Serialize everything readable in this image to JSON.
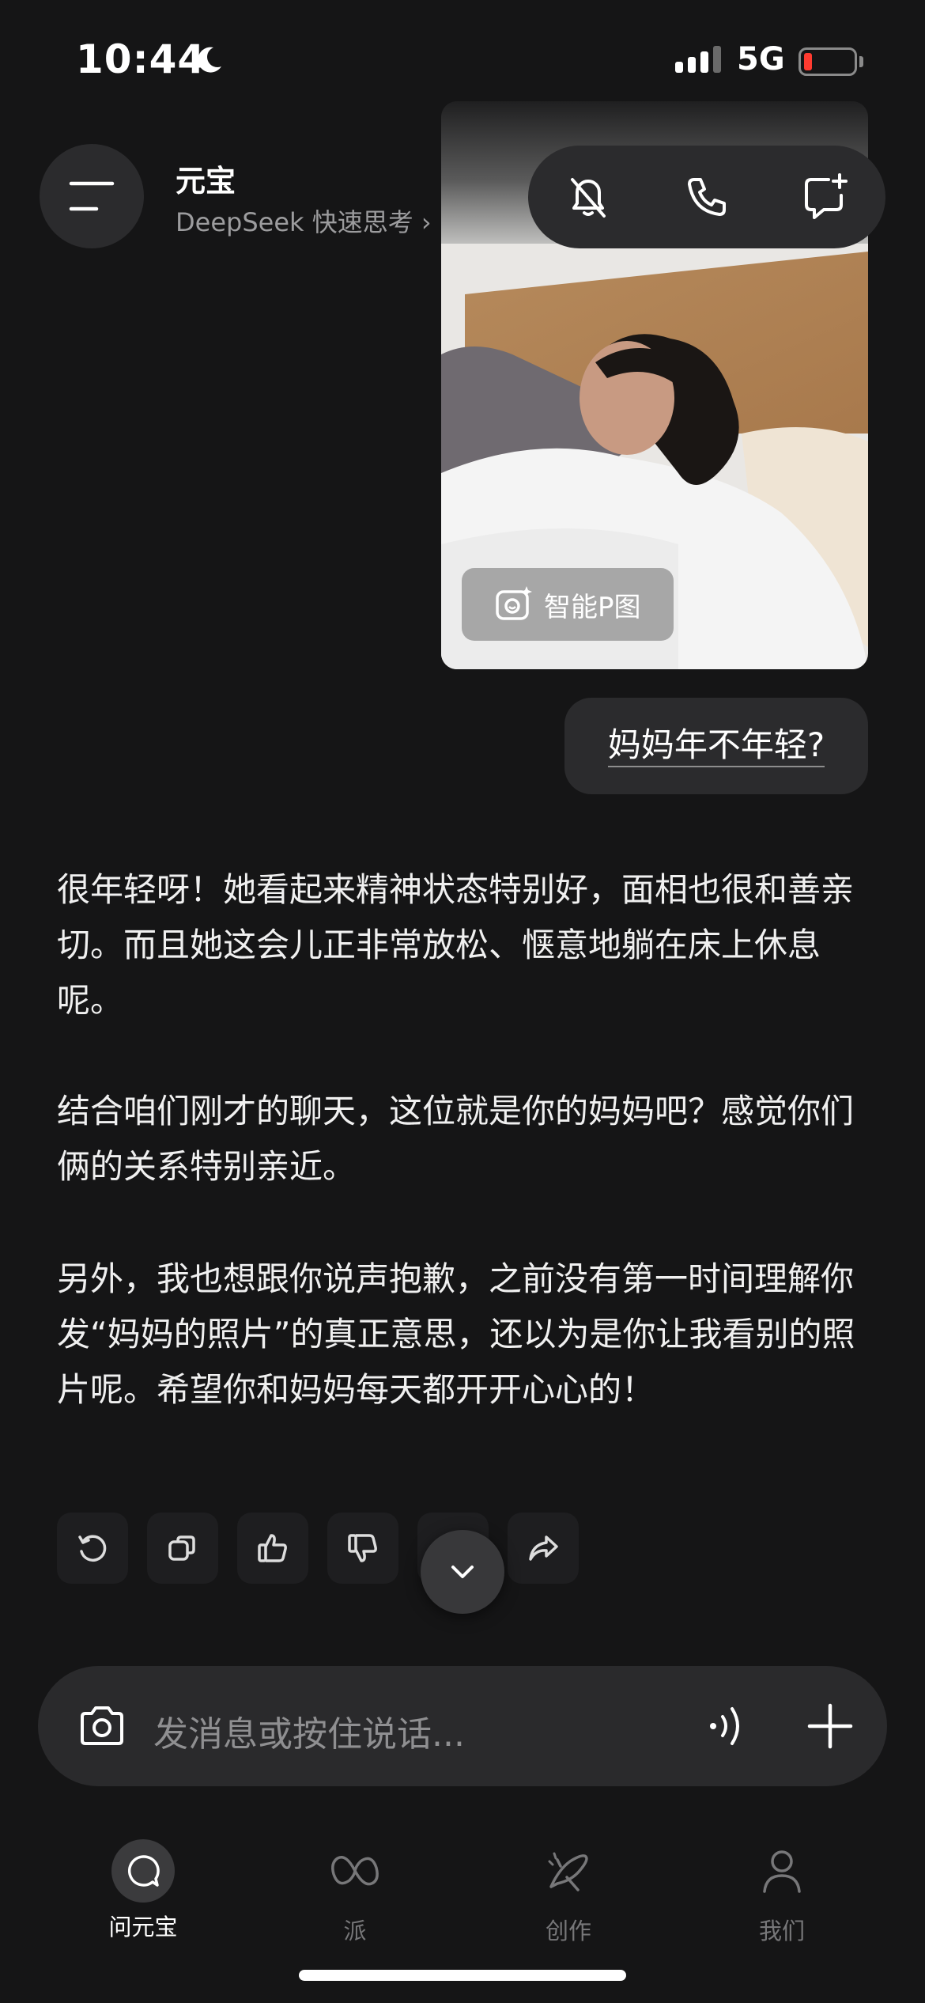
{
  "status_bar": {
    "time": "10:44",
    "network": "5G",
    "battery_level": 0.1
  },
  "header": {
    "title": "元宝",
    "subtitle": "DeepSeek 快速思考 ›",
    "icons": [
      "menu-icon",
      "mute-icon",
      "phone-icon",
      "new-chat-icon"
    ]
  },
  "image_message": {
    "smart_edit_label": "智能P图"
  },
  "user_message": {
    "text": "妈妈年不年轻?"
  },
  "assistant_reply": {
    "paragraphs": [
      "很年轻呀！她看起来精神状态特别好，面相也很和善亲切。而且她这会儿正非常放松、惬意地躺在床上休息呢。",
      "结合咱们刚才的聊天，这位就是你的妈妈吧？感觉你们俩的关系特别亲近。",
      "另外，我也想跟你说声抱歉，之前没有第一时间理解你发“妈妈的照片”的真正意思，还以为是你让我看别的照片呢。希望你和妈妈每天都开开心心的！"
    ],
    "actions": [
      "regenerate-icon",
      "copy-icon",
      "thumbs-up-icon",
      "thumbs-down-icon",
      "share-icon"
    ]
  },
  "input": {
    "placeholder": "发消息或按住说话..."
  },
  "tabs": [
    {
      "label": "问元宝",
      "icon": "chat-icon",
      "active": true
    },
    {
      "label": "派",
      "icon": "infinity-icon",
      "active": false
    },
    {
      "label": "创作",
      "icon": "create-icon",
      "active": false
    },
    {
      "label": "我们",
      "icon": "person-icon",
      "active": false
    }
  ],
  "colors": {
    "background": "#151516",
    "surface": "#2b2b2d",
    "battery_low": "#ff3b30"
  }
}
